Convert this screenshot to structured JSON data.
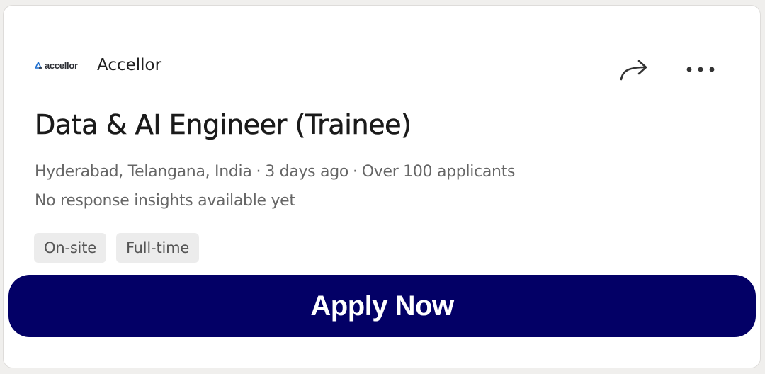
{
  "company": {
    "logo_text": "accellor",
    "name": "Accellor"
  },
  "job": {
    "title": "Data & AI Engineer (Trainee)",
    "location": "Hyderabad, Telangana, India",
    "posted": "3 days ago",
    "applicants": "Over 100 applicants",
    "separator": "·",
    "insights": "No response insights available yet"
  },
  "tags": [
    "On-site",
    "Full-time"
  ],
  "actions": {
    "share_icon": "share-arrow-icon",
    "more_icon": "more-horizontal-icon"
  },
  "apply": {
    "label": "Apply Now",
    "color": "#030066"
  }
}
